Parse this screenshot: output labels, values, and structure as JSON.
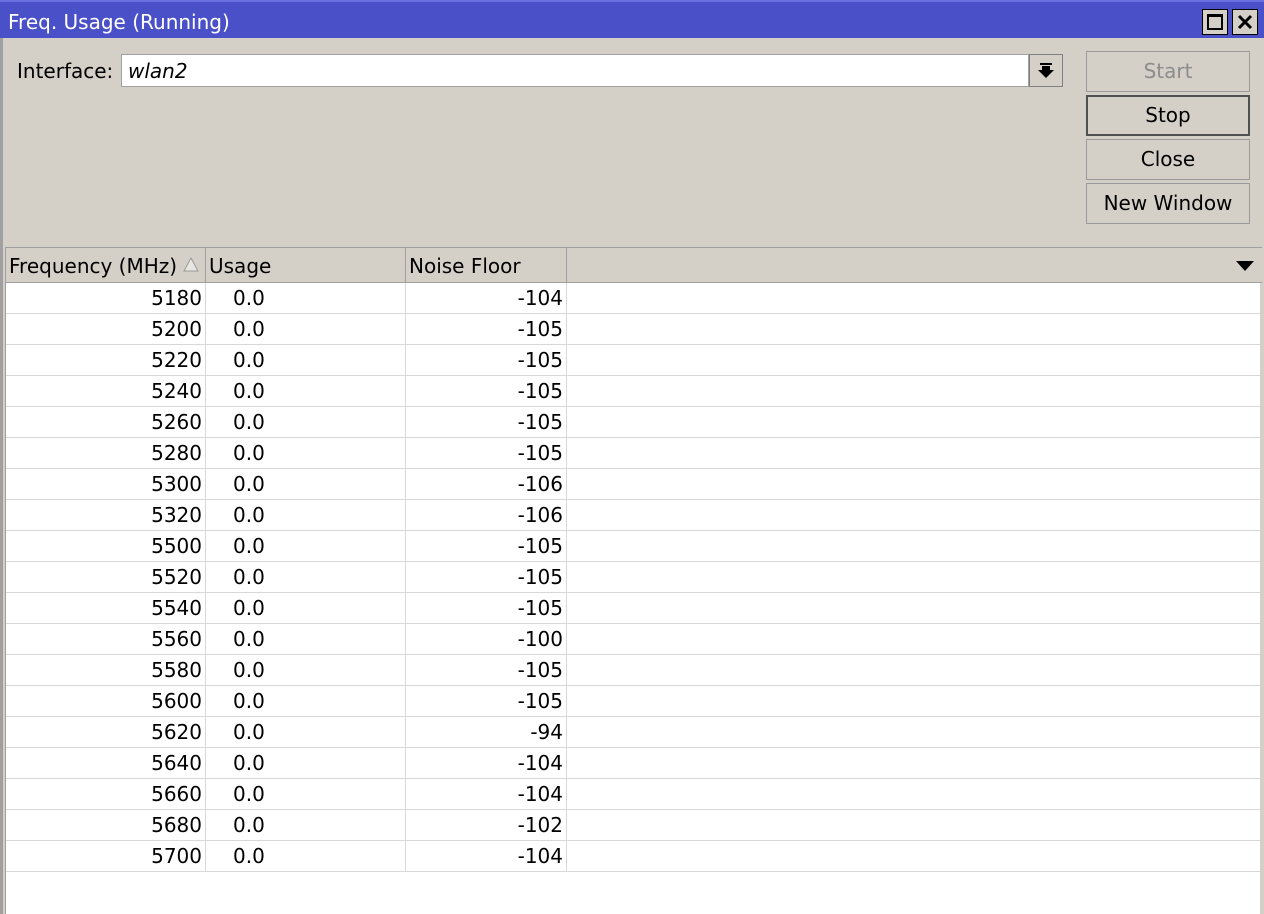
{
  "window": {
    "title": "Freq. Usage (Running)"
  },
  "interface": {
    "label": "Interface:",
    "value": "wlan2"
  },
  "buttons": {
    "start": "Start",
    "stop": "Stop",
    "close": "Close",
    "new_window": "New Window"
  },
  "table": {
    "columns": [
      "Frequency (MHz)",
      "Usage",
      "Noise Floor"
    ],
    "rows": [
      {
        "frequency": "5180",
        "usage": "0.0",
        "noise_floor": "-104"
      },
      {
        "frequency": "5200",
        "usage": "0.0",
        "noise_floor": "-105"
      },
      {
        "frequency": "5220",
        "usage": "0.0",
        "noise_floor": "-105"
      },
      {
        "frequency": "5240",
        "usage": "0.0",
        "noise_floor": "-105"
      },
      {
        "frequency": "5260",
        "usage": "0.0",
        "noise_floor": "-105"
      },
      {
        "frequency": "5280",
        "usage": "0.0",
        "noise_floor": "-105"
      },
      {
        "frequency": "5300",
        "usage": "0.0",
        "noise_floor": "-106"
      },
      {
        "frequency": "5320",
        "usage": "0.0",
        "noise_floor": "-106"
      },
      {
        "frequency": "5500",
        "usage": "0.0",
        "noise_floor": "-105"
      },
      {
        "frequency": "5520",
        "usage": "0.0",
        "noise_floor": "-105"
      },
      {
        "frequency": "5540",
        "usage": "0.0",
        "noise_floor": "-105"
      },
      {
        "frequency": "5560",
        "usage": "0.0",
        "noise_floor": "-100"
      },
      {
        "frequency": "5580",
        "usage": "0.0",
        "noise_floor": "-105"
      },
      {
        "frequency": "5600",
        "usage": "0.0",
        "noise_floor": "-105"
      },
      {
        "frequency": "5620",
        "usage": "0.0",
        "noise_floor": "-94"
      },
      {
        "frequency": "5640",
        "usage": "0.0",
        "noise_floor": "-104"
      },
      {
        "frequency": "5660",
        "usage": "0.0",
        "noise_floor": "-104"
      },
      {
        "frequency": "5680",
        "usage": "0.0",
        "noise_floor": "-102"
      },
      {
        "frequency": "5700",
        "usage": "0.0",
        "noise_floor": "-104"
      }
    ]
  },
  "icons": {
    "maximize": "maximize-icon",
    "close": "close-icon",
    "interface_dropdown": "dropdown-arrow-icon",
    "sort": "sort-ascending-icon",
    "column_menu": "chevron-down-icon"
  },
  "colors": {
    "titlebar": "#4a50c8",
    "title_text": "#ffffff",
    "window_bg": "#d4d0c8",
    "disabled_text": "#8c8c8c"
  }
}
